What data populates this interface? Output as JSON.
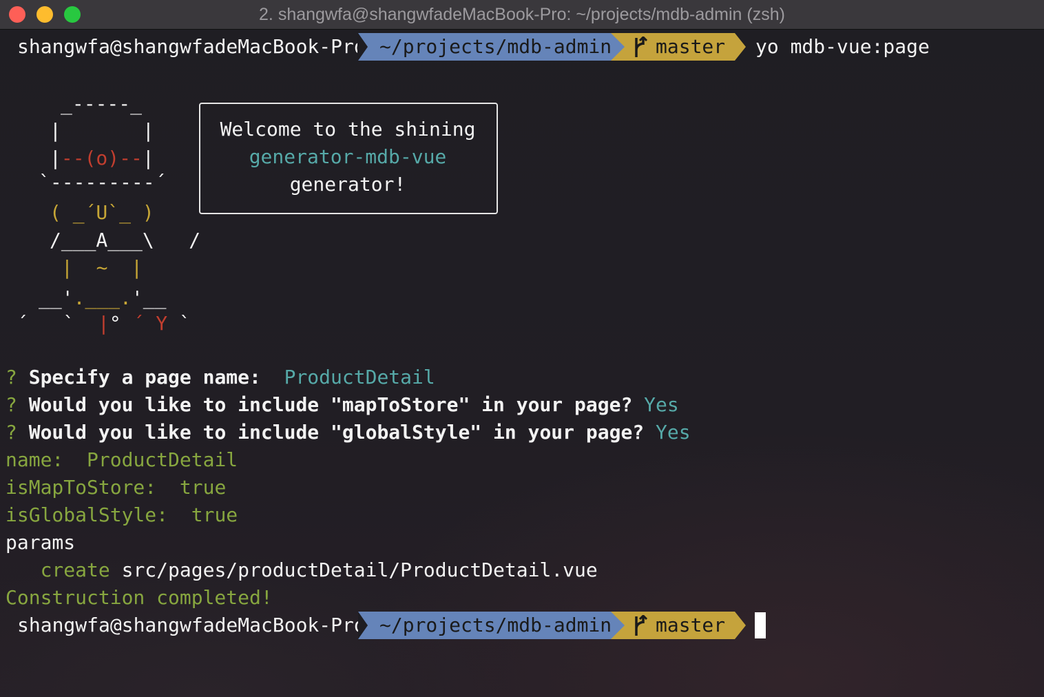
{
  "window": {
    "title": "2. shangwfa@shangwfadeMacBook-Pro: ~/projects/mdb-admin (zsh)"
  },
  "prompt": {
    "user_host": "shangwfa@shangwfadeMacBook-Pro",
    "directory": "~/projects/mdb-admin",
    "branch_icon": "git-branch-icon",
    "branch": "master",
    "command": "yo mdb-vue:page"
  },
  "welcome": {
    "line1": "Welcome to the shining",
    "generator_name": "generator-mdb-vue",
    "line3": "generator!"
  },
  "ascii_art": {
    "line1": "_-----_",
    "line2": "|       |",
    "line3_left": "|",
    "line3_mid": "--(o)--",
    "line3_right": "|",
    "line4": "`---------´",
    "line5": "( _´U`_ )",
    "line6": "/___A___\\   /",
    "line7": "|  ~  |",
    "line8a": "__'",
    "line8b": ".___.",
    "line8c": "'__",
    "line9a": "´   `  ",
    "line9b": "|",
    "line9c": "° ",
    "line9d": "´ Y",
    "line9e": " `"
  },
  "questions": [
    {
      "mark": "?",
      "text": "Specify a page name:",
      "answer": "ProductDetail"
    },
    {
      "mark": "?",
      "text": "Would you like to include \"mapToStore\" in your page?",
      "answer": "Yes"
    },
    {
      "mark": "?",
      "text": "Would you like to include \"globalStyle\" in your page?",
      "answer": "Yes"
    }
  ],
  "output": {
    "name_key": "name:",
    "name_value": "ProductDetail",
    "map_key": "isMapToStore:",
    "map_value": "true",
    "global_key": "isGlobalStyle:",
    "global_value": "true",
    "params": "params",
    "create_action": "create",
    "create_path": "src/pages/productDetail/ProductDetail.vue",
    "completed": "Construction completed!"
  },
  "colors": {
    "dir_segment": "#6584b9",
    "git_segment": "#c5a33c",
    "green": "#87a63f",
    "cyan": "#56a9a8",
    "yellow": "#c6a636",
    "red": "#c23e2f"
  }
}
